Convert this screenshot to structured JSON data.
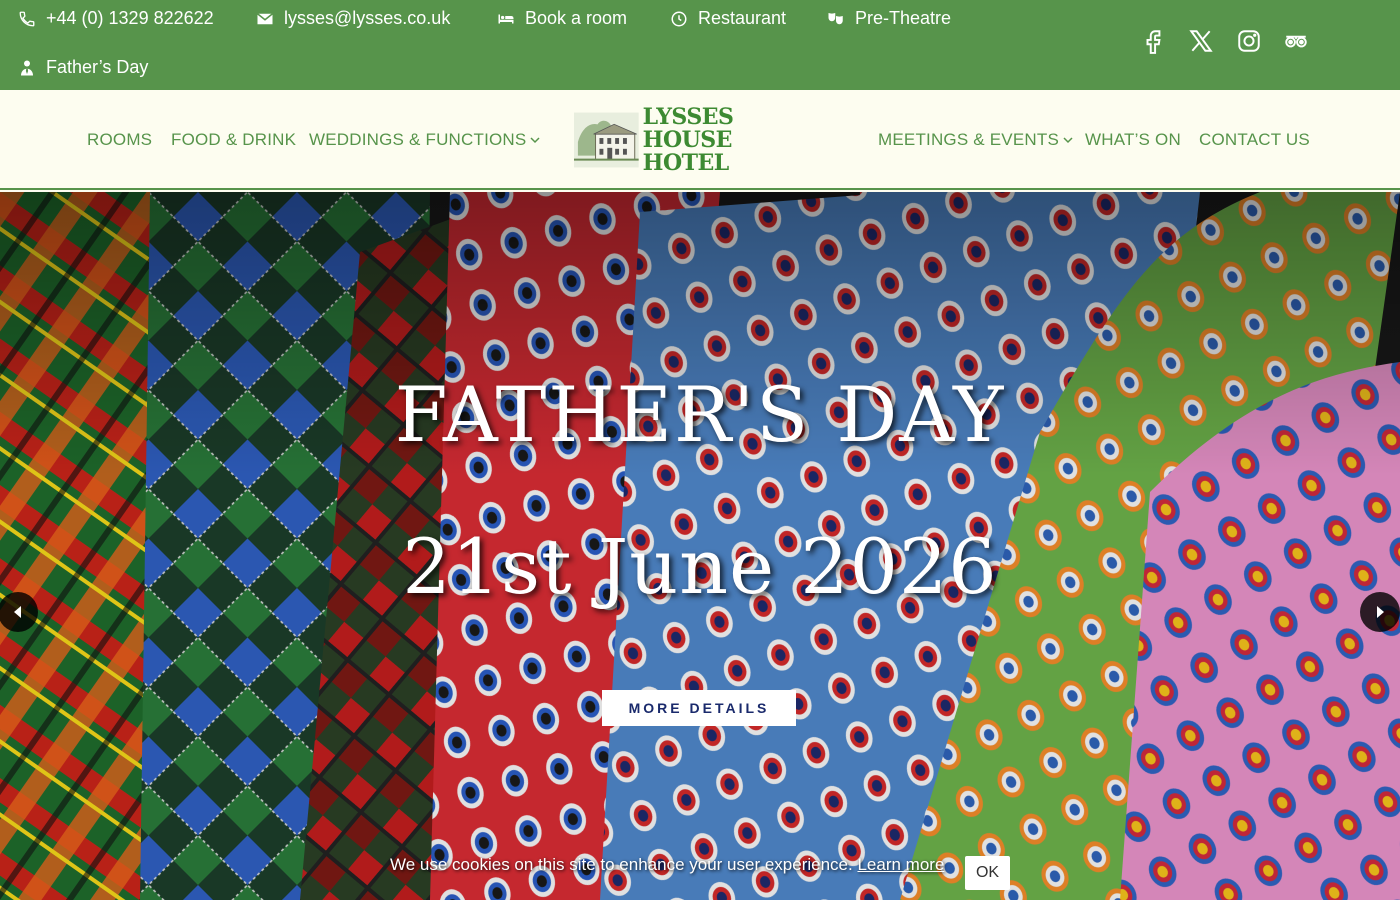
{
  "topbar": {
    "phone": "+44 (0) 1329 822622",
    "email": "lysses@lysses.co.uk",
    "book": "Book a room",
    "restaurant": "Restaurant",
    "pretheatre": "Pre-Theatre",
    "fathersday": "Father’s Day",
    "social": [
      "facebook-icon",
      "x-icon",
      "instagram-icon",
      "tripadvisor-icon"
    ]
  },
  "nav": {
    "rooms": "ROOMS",
    "food": "FOOD & DRINK",
    "weddings": "WEDDINGS & FUNCTIONS",
    "meetings": "MEETINGS & EVENTS",
    "whatson": "WHAT’S ON",
    "contact": "CONTACT US"
  },
  "logo": {
    "line1": "LYSSES HOUSE",
    "line2": "HOTEL"
  },
  "hero": {
    "title": "FATHER'S DAY",
    "date": "21st June 2026",
    "button": "MORE DETAILS"
  },
  "cookie": {
    "text": "We use cookies on this site to enhance your user experience.",
    "link": "Learn more",
    "ok": "OK"
  },
  "colors": {
    "brand_green": "#57944b",
    "header_bg": "#fdfdf0",
    "button_text": "#1a2a6c"
  }
}
